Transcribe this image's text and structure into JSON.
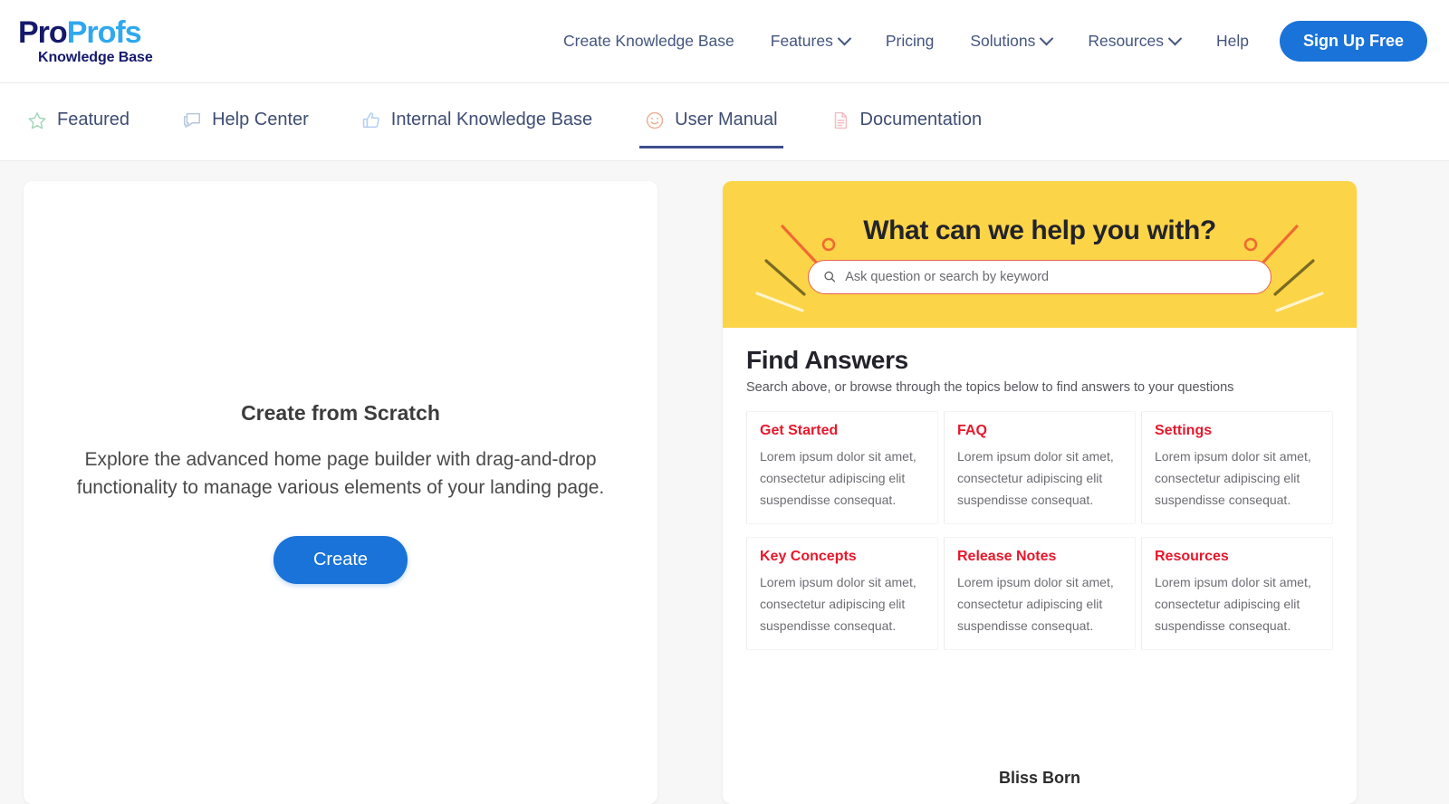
{
  "header": {
    "logo": {
      "part1": "Pro",
      "part2": "Profs",
      "subtitle": "Knowledge Base"
    },
    "nav": [
      {
        "label": "Create Knowledge Base",
        "caret": false,
        "name": "create-knowledge-base"
      },
      {
        "label": "Features",
        "caret": true,
        "name": "features"
      },
      {
        "label": "Pricing",
        "caret": false,
        "name": "pricing"
      },
      {
        "label": "Solutions",
        "caret": true,
        "name": "solutions"
      },
      {
        "label": "Resources",
        "caret": true,
        "name": "resources"
      },
      {
        "label": "Help",
        "caret": false,
        "name": "help"
      }
    ],
    "signup_label": "Sign Up Free"
  },
  "tabs": [
    {
      "label": "Featured",
      "icon": "star-icon",
      "active": false
    },
    {
      "label": "Help Center",
      "icon": "chat-icon",
      "active": false
    },
    {
      "label": "Internal Knowledge Base",
      "icon": "thumbs-up-icon",
      "active": false
    },
    {
      "label": "User Manual",
      "icon": "smiley-icon",
      "active": true
    },
    {
      "label": "Documentation",
      "icon": "document-icon",
      "active": false
    }
  ],
  "scratch": {
    "title": "Create from Scratch",
    "description": "Explore the advanced home page builder with drag-and-drop functionality to manage various elements of your landing page.",
    "button_label": "Create"
  },
  "preview": {
    "hero": {
      "title": "What can we help you with?",
      "search_placeholder": "Ask question or search by keyword",
      "search_value": "",
      "search_icon": "search-icon"
    },
    "answers": {
      "title": "Find Answers",
      "subtitle": "Search above, or browse through the topics below to find answers to your questions",
      "topics": [
        {
          "title": "Get Started",
          "body": "Lorem ipsum dolor sit amet, consectetur adipiscing  elit suspendisse consequat."
        },
        {
          "title": "FAQ",
          "body": "Lorem ipsum dolor sit amet, consectetur adipiscing  elit suspendisse consequat."
        },
        {
          "title": "Settings",
          "body": "Lorem ipsum dolor sit amet, consectetur adipiscing  elit suspendisse consequat."
        },
        {
          "title": "Key Concepts",
          "body": "Lorem ipsum dolor sit amet, consectetur adipiscing  elit suspendisse consequat."
        },
        {
          "title": "Release Notes",
          "body": "Lorem ipsum dolor sit amet, consectetur adipiscing  elit suspendisse consequat."
        },
        {
          "title": "Resources",
          "body": "Lorem ipsum dolor sit amet, consectetur adipiscing  elit suspendisse consequat."
        }
      ]
    },
    "footer_text": "Bliss Born"
  },
  "colors": {
    "brand_blue": "#1a73d8",
    "logo_navy": "#15196b",
    "logo_light_blue": "#2fa8f0",
    "nav_text": "#44557f",
    "hero_yellow": "#fcd447",
    "topic_red": "#e8172b",
    "search_border": "#e8604f",
    "page_bg": "#f7f7f7",
    "active_tab_underline": "#3f4d8f"
  }
}
